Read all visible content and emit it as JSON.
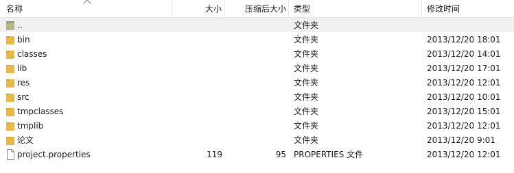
{
  "columns": {
    "name": "名称",
    "size": "大小",
    "compressed": "压缩后大小",
    "type": "类型",
    "modified": "修改时间"
  },
  "rows": [
    {
      "name": "..",
      "size": "",
      "compressed": "",
      "type": "文件夹",
      "modified": "",
      "icon": "folder-up-icon"
    },
    {
      "name": "bin",
      "size": "",
      "compressed": "",
      "type": "文件夹",
      "modified": "2013/12/20 18:01",
      "icon": "folder-icon"
    },
    {
      "name": "classes",
      "size": "",
      "compressed": "",
      "type": "文件夹",
      "modified": "2013/12/20 14:01",
      "icon": "folder-icon"
    },
    {
      "name": "lib",
      "size": "",
      "compressed": "",
      "type": "文件夹",
      "modified": "2013/12/20 17:01",
      "icon": "folder-icon"
    },
    {
      "name": "res",
      "size": "",
      "compressed": "",
      "type": "文件夹",
      "modified": "2013/12/20 12:01",
      "icon": "folder-icon"
    },
    {
      "name": "src",
      "size": "",
      "compressed": "",
      "type": "文件夹",
      "modified": "2013/12/20 10:01",
      "icon": "folder-icon"
    },
    {
      "name": "tmpclasses",
      "size": "",
      "compressed": "",
      "type": "文件夹",
      "modified": "2013/12/20 15:01",
      "icon": "folder-icon"
    },
    {
      "name": "tmplib",
      "size": "",
      "compressed": "",
      "type": "文件夹",
      "modified": "2013/12/20 12:01",
      "icon": "folder-icon"
    },
    {
      "name": "论文",
      "size": "",
      "compressed": "",
      "type": "文件夹",
      "modified": "2013/12/20 9:01",
      "icon": "folder-icon"
    },
    {
      "name": "project.properties",
      "size": "119",
      "compressed": "95",
      "type": "PROPERTIES 文件",
      "modified": "2013/12/20 12:01",
      "icon": "file-icon"
    }
  ],
  "colors": {
    "folder": "#e8b94a",
    "folder_up": "#b5b58a",
    "selected_row": "#f0f0f0",
    "header_border": "#e5e5e5"
  },
  "sort": {
    "column": "name",
    "direction": "ascending",
    "icon": "sort-up-icon"
  }
}
